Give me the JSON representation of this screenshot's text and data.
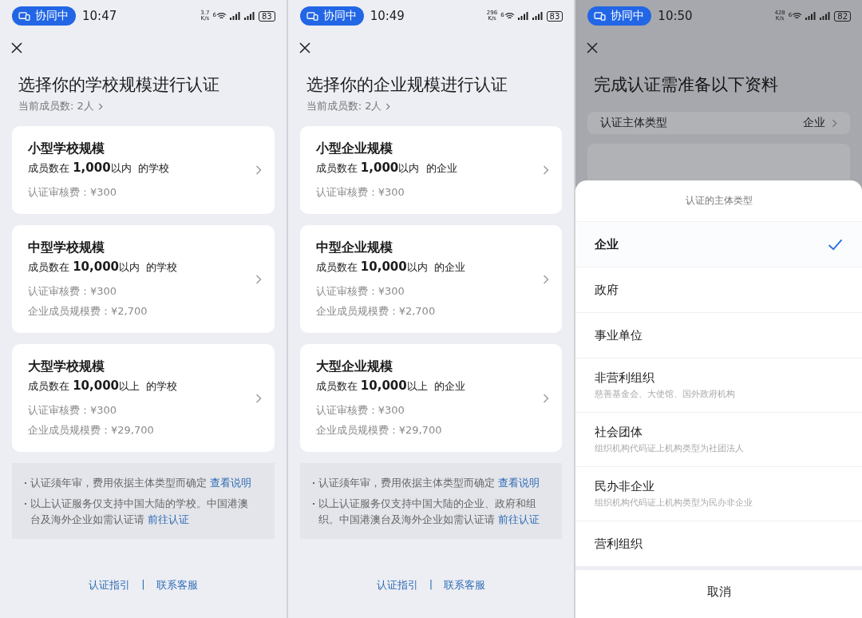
{
  "panels": [
    {
      "kind": "scale",
      "status": {
        "badge": "协同中",
        "time": "10:47",
        "speed": [
          "3.7",
          "K/s"
        ],
        "network": "6",
        "battery": "83"
      },
      "title": "选择你的学校规模进行认证",
      "subtitle": "当前成员数: 2人",
      "cards": [
        {
          "title": "小型学校规模",
          "desc": "成员数在 **1,000**以内  的学校",
          "fees": [
            "认证审核费：¥300"
          ]
        },
        {
          "title": "中型学校规模",
          "desc": "成员数在 **10,000**以内  的学校",
          "fees": [
            "认证审核费：¥300",
            "企业成员规模费：¥2,700"
          ]
        },
        {
          "title": "大型学校规模",
          "desc": "成员数在 **10,000**以上  的学校",
          "fees": [
            "认证审核费：¥300",
            "企业成员规模费：¥29,700"
          ]
        }
      ],
      "notes": [
        {
          "text": "认证须年审，费用依据主体类型而确定 ",
          "link": "查看说明"
        },
        {
          "text": "以上认证服务仅支持中国大陆的学校。中国港澳台及海外企业如需认证请 ",
          "link": "前往认证"
        }
      ],
      "footer": {
        "links": [
          "认证指引",
          "联系客服"
        ],
        "separator": "|"
      }
    },
    {
      "kind": "scale",
      "status": {
        "badge": "协同中",
        "time": "10:49",
        "speed": [
          "296",
          "K/s"
        ],
        "network": "6",
        "battery": "83"
      },
      "title": "选择你的企业规模进行认证",
      "subtitle": "当前成员数: 2人",
      "cards": [
        {
          "title": "小型企业规模",
          "desc": "成员数在 **1,000**以内  的企业",
          "fees": [
            "认证审核费：¥300"
          ]
        },
        {
          "title": "中型企业规模",
          "desc": "成员数在 **10,000**以内  的企业",
          "fees": [
            "认证审核费：¥300",
            "企业成员规模费：¥2,700"
          ]
        },
        {
          "title": "大型企业规模",
          "desc": "成员数在 **10,000**以上  的企业",
          "fees": [
            "认证审核费：¥300",
            "企业成员规模费：¥29,700"
          ]
        }
      ],
      "notes": [
        {
          "text": "认证须年审，费用依据主体类型而确定 ",
          "link": "查看说明"
        },
        {
          "text": "以上认证服务仅支持中国大陆的企业、政府和组织。中国港澳台及海外企业如需认证请 ",
          "link": "前往认证"
        }
      ],
      "footer": {
        "links": [
          "认证指引",
          "联系客服"
        ],
        "separator": "|"
      }
    },
    {
      "kind": "materials",
      "status": {
        "badge": "协同中",
        "time": "10:50",
        "speed": [
          "428",
          "K/s"
        ],
        "network": "6",
        "battery": "82"
      },
      "title": "完成认证需准备以下资料",
      "rows": [
        {
          "label": "认证主体类型",
          "value": "企业"
        }
      ],
      "sheet": {
        "title": "认证的主体类型",
        "options": [
          {
            "label": "企业",
            "selected": true
          },
          {
            "label": "政府",
            "selected": false
          },
          {
            "label": "事业单位",
            "selected": false
          },
          {
            "label": "非营利组织",
            "hint": "慈善基金会、大使馆、国外政府机构",
            "selected": false
          },
          {
            "label": "社会团体",
            "hint": "组织机构代码证上机构类型为社团法人",
            "selected": false
          },
          {
            "label": "民办非企业",
            "hint": "组织机构代码证上机构类型为民办非企业",
            "selected": false
          },
          {
            "label": "营利组织",
            "selected": false
          }
        ],
        "cancel": "取消"
      }
    }
  ]
}
